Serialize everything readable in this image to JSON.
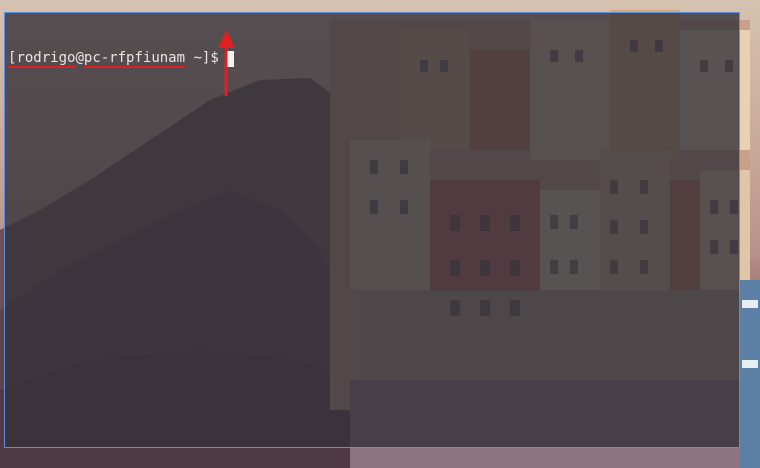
{
  "terminal": {
    "prompt": {
      "open_bracket": "[",
      "user": "rodrigo",
      "at": "@",
      "host": "pc-rfpfiunam",
      "space": " ",
      "dir": "~",
      "close": "]$"
    }
  },
  "colors": {
    "annotation": "#e02020",
    "window_border": "#5d8fe0",
    "terminal_bg": "#34323a"
  },
  "icons": {
    "annotation_arrow": "arrow-up-icon"
  }
}
